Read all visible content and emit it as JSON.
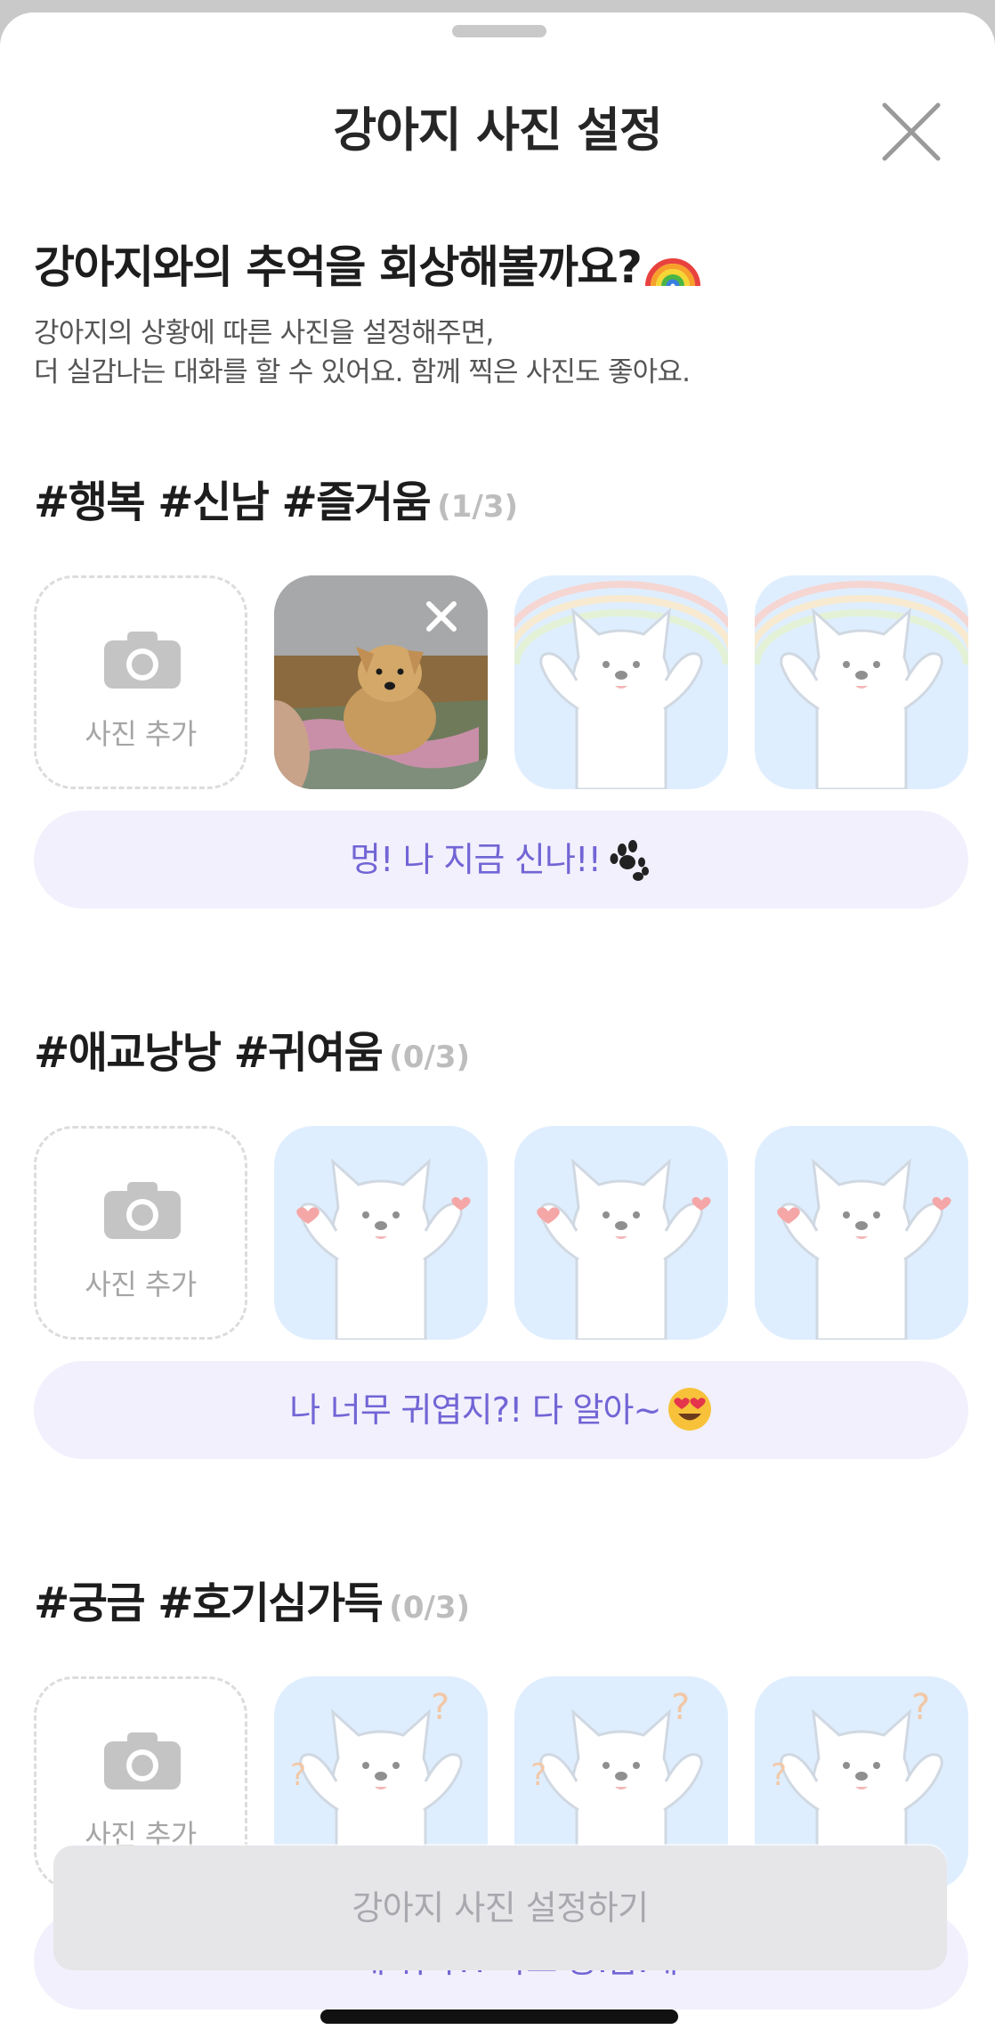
{
  "header": {
    "title": "강아지 사진 설정",
    "close_icon": "close-icon"
  },
  "intro": {
    "title": "강아지와의 추억을 회상해볼까요?",
    "title_emoji": "rainbow-icon",
    "desc_line1": "강아지의 상황에 따른 사진을 설정해주면,",
    "desc_line2": "더 실감나는 대화를 할 수 있어요. 함께 찍은 사진도 좋아요."
  },
  "add_photo_label": "사진 추가",
  "sections": [
    {
      "title": "#행복 #신남 #즐거움",
      "count": "(1/3)",
      "message": "멍! 나 지금 신나!!",
      "message_icon": "paw-icon",
      "slots": [
        "photo",
        "placeholder-rainbow-dog",
        "placeholder-rainbow-dog"
      ]
    },
    {
      "title": "#애교낭낭 #귀여움",
      "count": "(0/3)",
      "message": "나 너무 귀엽지?! 다 알아~",
      "message_icon": "heart-eyes-icon",
      "slots": [
        "placeholder-heart-dog",
        "placeholder-heart-dog",
        "placeholder-heart-dog"
      ]
    },
    {
      "title": "#궁금 #호기심가득",
      "count": "(0/3)",
      "message": "그게 뭐야?! 나도 궁.금.해",
      "slots": [
        "placeholder-question-dog",
        "placeholder-question-dog",
        "placeholder-question-dog"
      ]
    }
  ],
  "cta_label": "강아지 사진 설정하기",
  "colors": {
    "accent": "#7265d5",
    "pill_bg": "#f2f0fd",
    "placeholder_bg": "#dfeefe",
    "cta_bg": "#e6e6e9"
  }
}
